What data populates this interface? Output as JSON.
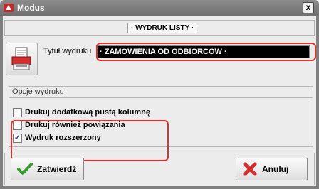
{
  "window": {
    "title": "Modus",
    "close_glyph": "x"
  },
  "header": {
    "label": "· WYDRUK LISTY ·"
  },
  "form": {
    "print_button_icon": "printer-icon",
    "title_label": "Tytuł wydruku",
    "title_value": "· ZAMÓWIENIA OD ODBIORCÓW ·"
  },
  "options": {
    "group_title": "Opcje wydruku",
    "items": [
      {
        "label": "Drukuj dodatkową pustą kolumnę",
        "checked": false
      },
      {
        "label": "Drukuj również powiązania",
        "checked": false
      },
      {
        "label": "Wydruk rozszerzony",
        "checked": true
      }
    ]
  },
  "buttons": {
    "confirm_label": "Zatwierdź",
    "cancel_label": "Anuluj"
  },
  "colors": {
    "highlight": "#e0312f",
    "titlebar": "#7a7a7a"
  }
}
